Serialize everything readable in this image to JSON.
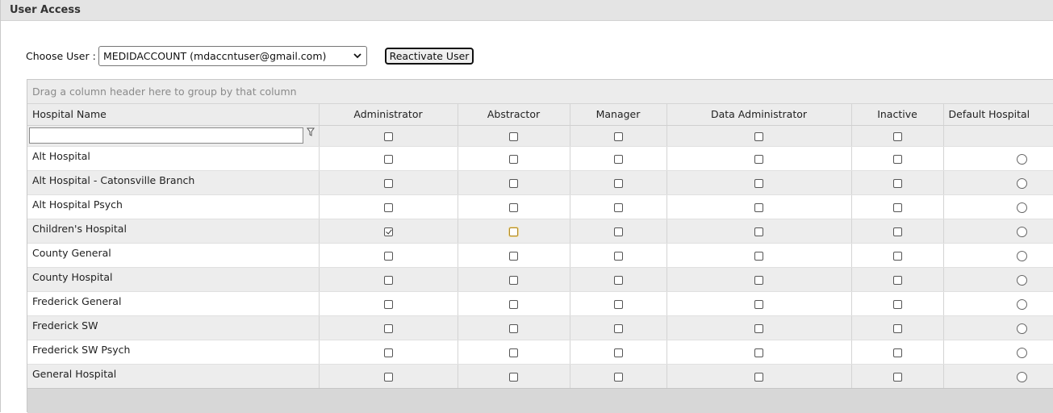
{
  "panel": {
    "title": "User Access"
  },
  "user_picker": {
    "label": "Choose User :",
    "selected": "MEDIDACCOUNT (mdaccntuser@gmail.com)"
  },
  "reactivate_label": "Reactivate User",
  "grid": {
    "group_hint": "Drag a column header here to group by that column",
    "columns": [
      "Hospital Name",
      "Administrator",
      "Abstractor",
      "Manager",
      "Data Administrator",
      "Inactive",
      "Default Hospital"
    ],
    "rows": [
      {
        "name": "Alt Hospital",
        "administrator": false,
        "abstractor": false,
        "manager": false,
        "data_administrator": false,
        "inactive": false,
        "default": false
      },
      {
        "name": "Alt Hospital - Catonsville Branch",
        "administrator": false,
        "abstractor": false,
        "manager": false,
        "data_administrator": false,
        "inactive": false,
        "default": false
      },
      {
        "name": "Alt Hospital Psych",
        "administrator": false,
        "abstractor": false,
        "manager": false,
        "data_administrator": false,
        "inactive": false,
        "default": false
      },
      {
        "name": "Children's Hospital",
        "administrator": true,
        "abstractor": false,
        "manager": false,
        "data_administrator": false,
        "inactive": false,
        "default": false
      },
      {
        "name": "County General",
        "administrator": false,
        "abstractor": false,
        "manager": false,
        "data_administrator": false,
        "inactive": false,
        "default": false
      },
      {
        "name": "County Hospital",
        "administrator": false,
        "abstractor": false,
        "manager": false,
        "data_administrator": false,
        "inactive": false,
        "default": false
      },
      {
        "name": "Frederick General",
        "administrator": false,
        "abstractor": false,
        "manager": false,
        "data_administrator": false,
        "inactive": false,
        "default": false
      },
      {
        "name": "Frederick SW",
        "administrator": false,
        "abstractor": false,
        "manager": false,
        "data_administrator": false,
        "inactive": false,
        "default": false
      },
      {
        "name": "Frederick SW Psych",
        "administrator": false,
        "abstractor": false,
        "manager": false,
        "data_administrator": false,
        "inactive": false,
        "default": false
      },
      {
        "name": "General Hospital",
        "administrator": false,
        "abstractor": false,
        "manager": false,
        "data_administrator": false,
        "inactive": false,
        "default": false
      }
    ]
  },
  "icons": {
    "filter": "filter-icon",
    "dropdown": "chevron-down-icon"
  }
}
